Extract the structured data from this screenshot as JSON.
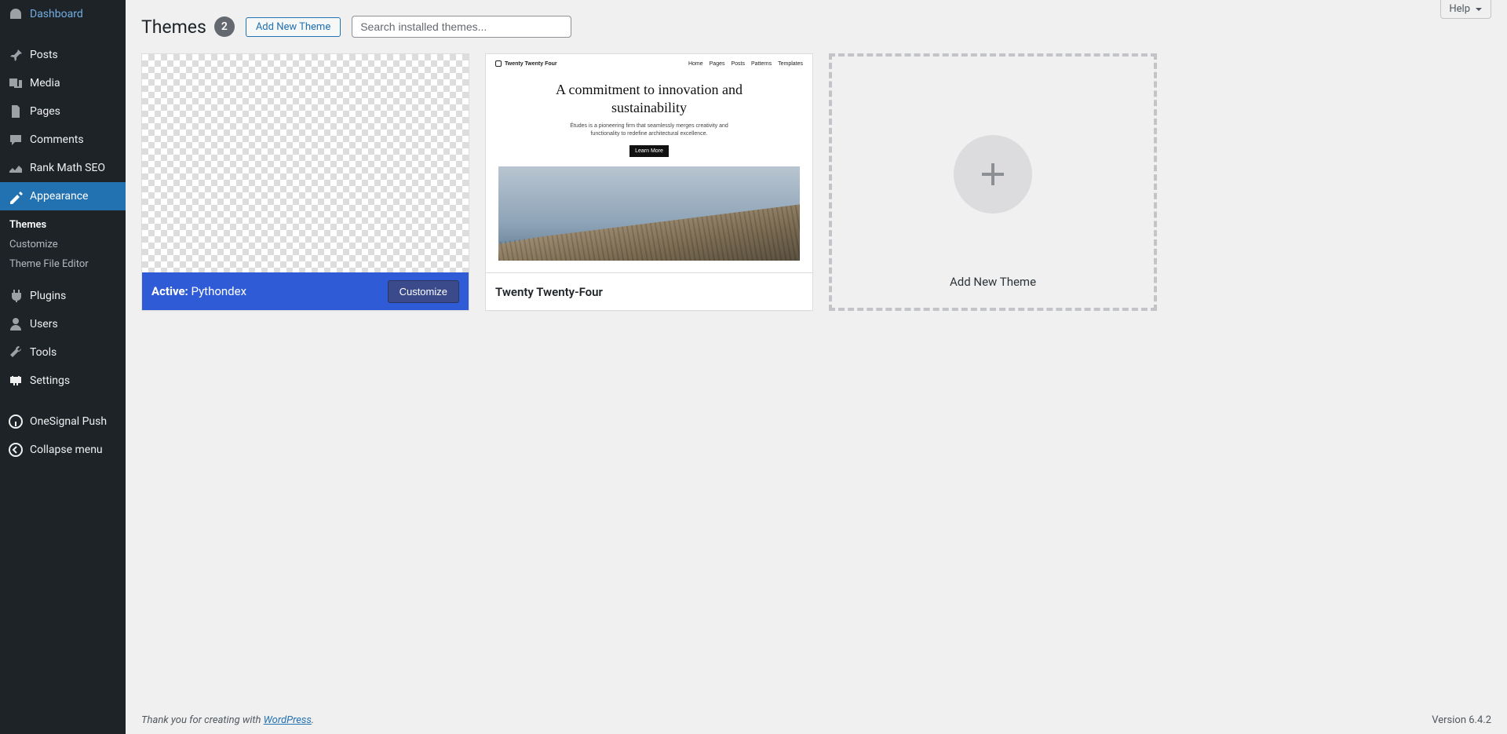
{
  "sidebar": {
    "items": [
      {
        "label": "Dashboard",
        "icon": "dashboard"
      },
      {
        "label": "Posts",
        "icon": "pin"
      },
      {
        "label": "Media",
        "icon": "media"
      },
      {
        "label": "Pages",
        "icon": "pages"
      },
      {
        "label": "Comments",
        "icon": "comments"
      },
      {
        "label": "Rank Math SEO",
        "icon": "rankmath"
      },
      {
        "label": "Appearance",
        "icon": "appearance",
        "current": true
      },
      {
        "label": "Plugins",
        "icon": "plugins"
      },
      {
        "label": "Users",
        "icon": "users"
      },
      {
        "label": "Tools",
        "icon": "tools"
      },
      {
        "label": "Settings",
        "icon": "settings"
      },
      {
        "label": "OneSignal Push",
        "icon": "onesignal"
      },
      {
        "label": "Collapse menu",
        "icon": "collapse"
      }
    ],
    "submenu": [
      {
        "label": "Themes",
        "current": true
      },
      {
        "label": "Customize"
      },
      {
        "label": "Theme File Editor"
      }
    ]
  },
  "help_label": "Help",
  "page": {
    "title": "Themes",
    "count": "2",
    "add_new": "Add New Theme",
    "search_placeholder": "Search installed themes..."
  },
  "themes": {
    "active": {
      "prefix": "Active:",
      "name": "Pythondex",
      "customize": "Customize"
    },
    "other": {
      "name": "Twenty Twenty-Four",
      "preview": {
        "brand": "Twenty Twenty Four",
        "nav": [
          "Home",
          "Pages",
          "Posts",
          "Patterns",
          "Templates"
        ],
        "headline": "A commitment to innovation and sustainability",
        "sub": "Études is a pioneering firm that seamlessly merges creativity and functionality to redefine architectural excellence.",
        "cta": "Learn More"
      }
    },
    "add_card": "Add New Theme"
  },
  "footer": {
    "thanks_pre": "Thank you for creating with ",
    "thanks_link": "WordPress",
    "thanks_post": ".",
    "version": "Version 6.4.2"
  }
}
